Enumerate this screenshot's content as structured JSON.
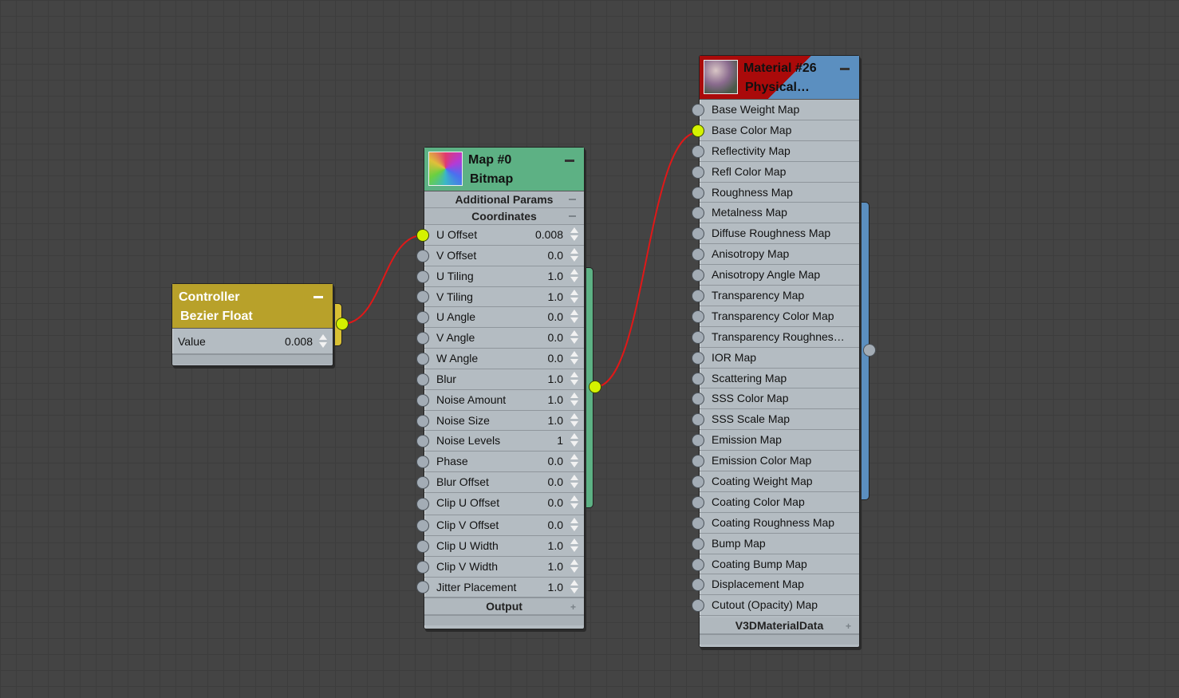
{
  "controller": {
    "title": "Controller",
    "subtitle": "Bezier Float",
    "param_label": "Value",
    "param_value": "0.008",
    "color": "#b8a12a"
  },
  "bitmap": {
    "title": "Map #0",
    "subtitle": "Bitmap",
    "sections": {
      "additional": "Additional Params",
      "coordinates": "Coordinates",
      "output": "Output"
    },
    "color": "#5db184",
    "params": [
      {
        "label": "U Offset",
        "value": "0.008",
        "connected": true
      },
      {
        "label": "V Offset",
        "value": "0.0"
      },
      {
        "label": "U Tiling",
        "value": "1.0"
      },
      {
        "label": "V Tiling",
        "value": "1.0"
      },
      {
        "label": "U Angle",
        "value": "0.0"
      },
      {
        "label": "V Angle",
        "value": "0.0"
      },
      {
        "label": "W Angle",
        "value": "0.0"
      },
      {
        "label": "Blur",
        "value": "1.0"
      },
      {
        "label": "Noise Amount",
        "value": "1.0"
      },
      {
        "label": "Noise Size",
        "value": "1.0"
      },
      {
        "label": "Noise Levels",
        "value": "1"
      },
      {
        "label": "Phase",
        "value": "0.0"
      },
      {
        "label": "Blur Offset",
        "value": "0.0"
      },
      {
        "label": "Clip U Offset",
        "value": "0.0"
      },
      {
        "label": "Clip V Offset",
        "value": "0.0"
      },
      {
        "label": "Clip U Width",
        "value": "1.0"
      },
      {
        "label": "Clip V Width",
        "value": "1.0"
      },
      {
        "label": "Jitter Placement",
        "value": "1.0"
      }
    ]
  },
  "material": {
    "title": "Material #26",
    "subtitle": "Physical…",
    "footer": "V3DMaterialData",
    "color": "#5b8fc0",
    "accent": "#aa0a0a",
    "slots": [
      {
        "label": "Base Weight Map"
      },
      {
        "label": "Base Color Map",
        "connected": true
      },
      {
        "label": "Reflectivity Map"
      },
      {
        "label": "Refl Color Map"
      },
      {
        "label": "Roughness Map"
      },
      {
        "label": "Metalness Map"
      },
      {
        "label": "Diffuse Roughness Map"
      },
      {
        "label": "Anisotropy Map"
      },
      {
        "label": "Anisotropy Angle Map"
      },
      {
        "label": "Transparency Map"
      },
      {
        "label": "Transparency Color Map"
      },
      {
        "label": "Transparency  Roughnes…"
      },
      {
        "label": "IOR Map"
      },
      {
        "label": "Scattering Map"
      },
      {
        "label": "SSS Color Map"
      },
      {
        "label": "SSS Scale Map"
      },
      {
        "label": "Emission Map"
      },
      {
        "label": "Emission Color Map"
      },
      {
        "label": "Coating Weight Map"
      },
      {
        "label": "Coating Color Map"
      },
      {
        "label": "Coating Roughness Map"
      },
      {
        "label": "Bump Map"
      },
      {
        "label": "Coating Bump Map"
      },
      {
        "label": "Displacement Map"
      },
      {
        "label": "Cutout (Opacity) Map"
      }
    ]
  },
  "wire_color": "#e01818"
}
